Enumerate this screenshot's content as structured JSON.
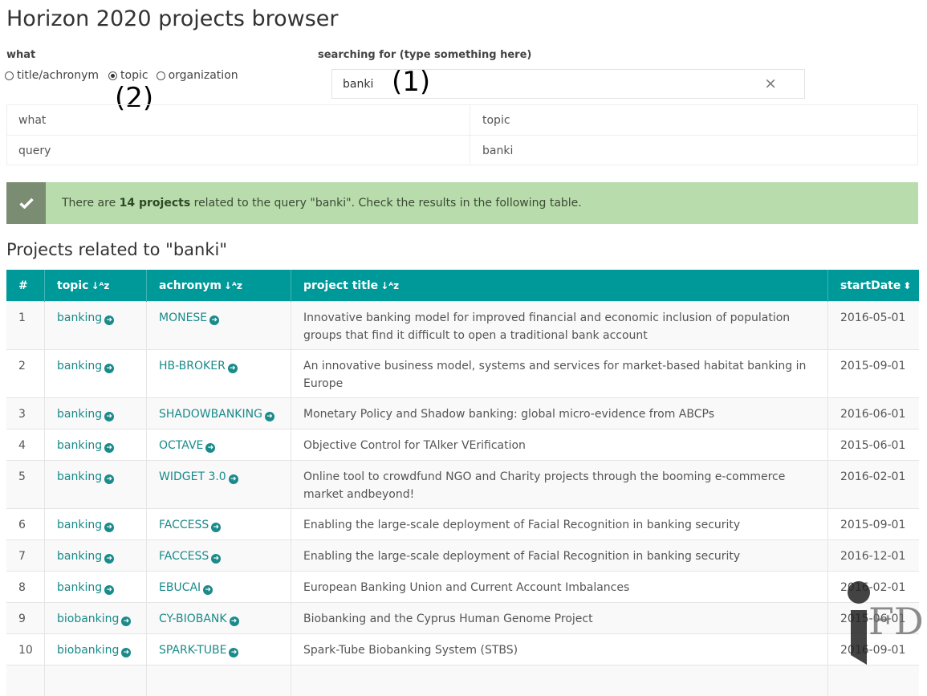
{
  "page": {
    "title": "Horizon 2020 projects browser"
  },
  "controls": {
    "what_label": "what",
    "search_label": "searching for (type something here)",
    "radios": [
      {
        "label": "title/achronym",
        "checked": false
      },
      {
        "label": "topic",
        "checked": true
      },
      {
        "label": "organization",
        "checked": false
      }
    ],
    "search_value": "banki",
    "clear_glyph": "×"
  },
  "annotations": {
    "one": "(1)",
    "two": "(2)"
  },
  "summary": {
    "rows": [
      {
        "key": "what",
        "value": "topic"
      },
      {
        "key": "query",
        "value": "banki"
      }
    ]
  },
  "alert": {
    "prefix": "There are ",
    "count": "14 projects",
    "suffix": " related to the query \"banki\". Check the results in the following table.",
    "color": "#b8dcab"
  },
  "results_title": "Projects related to \"banki\"",
  "table": {
    "headers": {
      "num": "#",
      "topic": "topic",
      "acronym": "achronym",
      "title": "project title",
      "start": "startDate"
    },
    "header_color": "#009999",
    "rows": [
      {
        "n": "1",
        "topic": "banking",
        "acronym": "MONESE",
        "title": "Innovative banking model for improved financial and economic inclusion of population groups that find it difficult to open a traditional bank account",
        "start": "2016-05-01"
      },
      {
        "n": "2",
        "topic": "banking",
        "acronym": "HB-BROKER",
        "title": "An innovative business model, systems and services for market-based habitat banking in Europe",
        "start": "2015-09-01"
      },
      {
        "n": "3",
        "topic": "banking",
        "acronym": "SHADOWBANKING",
        "title": "Monetary Policy and Shadow banking: global micro-evidence from ABCPs",
        "start": "2016-06-01"
      },
      {
        "n": "4",
        "topic": "banking",
        "acronym": "OCTAVE",
        "title": "Objective Control for TAlker VErification",
        "start": "2015-06-01"
      },
      {
        "n": "5",
        "topic": "banking",
        "acronym": "WIDGET 3.0",
        "title": "Online tool to crowdfund NGO and Charity projects through the booming e-commerce market andbeyond!",
        "start": "2016-02-01"
      },
      {
        "n": "6",
        "topic": "banking",
        "acronym": "FACCESS",
        "title": "Enabling the large-scale deployment of Facial Recognition in banking security",
        "start": "2015-09-01"
      },
      {
        "n": "7",
        "topic": "banking",
        "acronym": "FACCESS",
        "title": "Enabling the large-scale deployment of Facial Recognition in banking security",
        "start": "2016-12-01"
      },
      {
        "n": "8",
        "topic": "banking",
        "acronym": "EBUCAI",
        "title": "European Banking Union and Current Account Imbalances",
        "start": "2016-02-01"
      },
      {
        "n": "9",
        "topic": "biobanking",
        "acronym": "CY-BIOBANK",
        "title": "Biobanking and the Cyprus Human Genome Project",
        "start": "2015-06-01"
      },
      {
        "n": "10",
        "topic": "biobanking",
        "acronym": "SPARK-TUBE",
        "title": "Spark-Tube Biobanking System (STBS)",
        "start": "2016-09-01"
      },
      {
        "n": "",
        "topic": "",
        "acronym": "",
        "title": "",
        "start": ""
      }
    ]
  },
  "watermark": {
    "text": "FD"
  }
}
